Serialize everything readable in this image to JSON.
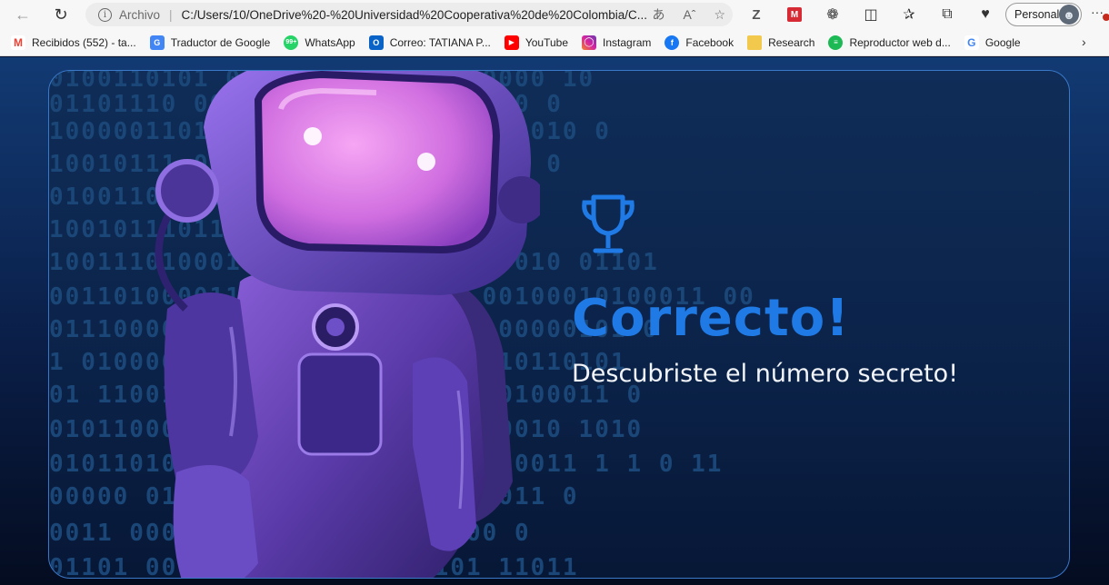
{
  "browser": {
    "address": {
      "scheme": "Archivo",
      "url": "C:/Users/10/OneDrive%20-%20Universidad%20Cooperativa%20de%20Colombia/C...",
      "actions": [
        "read-aloud-icon",
        "text-size-icon",
        "favorite-star-icon"
      ]
    },
    "toolbar_icons": [
      "z-extension-icon",
      "red-extension-icon",
      "extensions-icon",
      "split-screen-icon",
      "favorites-icon",
      "collections-icon",
      "performance-icon"
    ],
    "profile": {
      "label": "Personal"
    },
    "bookmarks": [
      {
        "label": "Recibidos (552) - ta...",
        "icon": "gmail-icon",
        "color": "#ea4335"
      },
      {
        "label": "Traductor de Google",
        "icon": "translate-icon",
        "color": "#4285f4"
      },
      {
        "label": "WhatsApp",
        "icon": "whatsapp-icon",
        "color": "#25d366"
      },
      {
        "label": "Correo: TATIANA P...",
        "icon": "outlook-icon",
        "color": "#0a64c8"
      },
      {
        "label": "YouTube",
        "icon": "youtube-icon",
        "color": "#ff0000"
      },
      {
        "label": "Instagram",
        "icon": "instagram-icon",
        "color": "#d6249f"
      },
      {
        "label": "Facebook",
        "icon": "facebook-icon",
        "color": "#1877f2"
      },
      {
        "label": "Research",
        "icon": "folder-icon",
        "color": "#f2c94c"
      },
      {
        "label": "Reproductor web d...",
        "icon": "spotify-icon",
        "color": "#1db954"
      },
      {
        "label": "Google",
        "icon": "google-icon",
        "color": "#4285f4"
      }
    ]
  },
  "page": {
    "title": "Correcto!",
    "subtitle": "Descubriste el número secreto!",
    "accent_color": "#1f7ae6",
    "trophy_icon": "trophy-icon"
  }
}
